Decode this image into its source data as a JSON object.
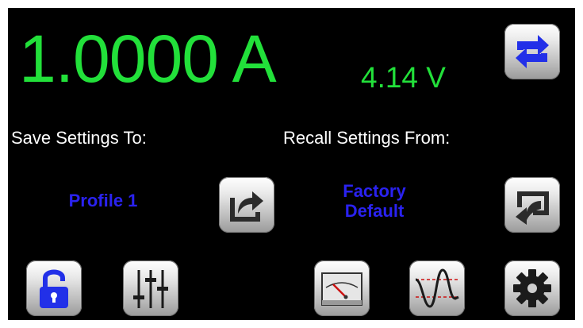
{
  "readout": {
    "current": "1.0000 A",
    "voltage": "4.14 V"
  },
  "save": {
    "label": "Save Settings To:",
    "profile": "Profile 1"
  },
  "recall": {
    "label": "Recall Settings From:",
    "profile_line1": "Factory",
    "profile_line2": "Default"
  },
  "icons": {
    "top_right": "swap-arrows-icon",
    "save": "export-arrow-icon",
    "recall": "import-arrow-icon",
    "lock": "unlocked-padlock-icon",
    "sliders": "sliders-icon",
    "meter": "analog-meter-icon",
    "waveform": "sine-wave-icon",
    "settings": "gear-icon"
  },
  "colors": {
    "reading": "#22e03a",
    "profile_text": "#2a22f0",
    "accent_blue": "#2230e8"
  }
}
